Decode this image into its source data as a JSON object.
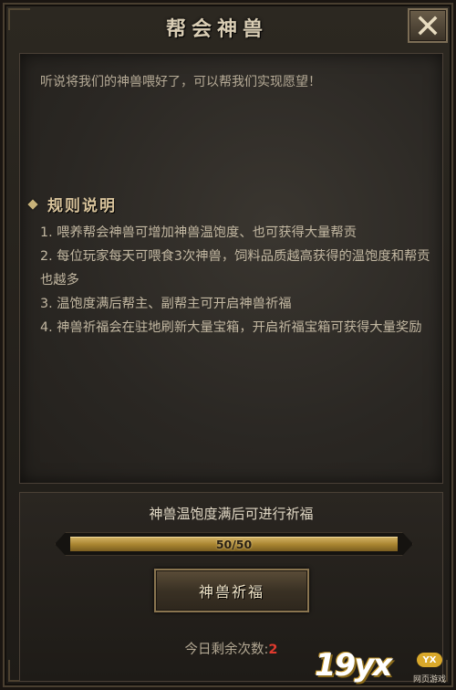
{
  "window": {
    "title": "帮会神兽"
  },
  "intro_text": "听说将我们的神兽喂好了，可以帮我们实现愿望！",
  "rules": {
    "title": "规则说明",
    "items": [
      "1. 喂养帮会神兽可增加神兽温饱度、也可获得大量帮贡",
      "2. 每位玩家每天可喂食3次神兽，饲料品质越高获得的温饱度和帮贡也越多",
      "3. 温饱度满后帮主、副帮主可开启神兽祈福",
      "4. 神兽祈福会在驻地刷新大量宝箱，开启祈福宝箱可获得大量奖励"
    ]
  },
  "satiety": {
    "hint": "神兽温饱度满后可进行祈福",
    "progress_text": "50/50",
    "progress_fraction": 1.0
  },
  "bless_button_label": "神兽祈福",
  "remaining": {
    "label": "今日剩余次数:",
    "count": "2"
  },
  "colors": {
    "accent_gold": "#c9a44e",
    "count_red": "#e03a2e"
  },
  "watermark": {
    "logo": "19yx",
    "badge": "YX",
    "sub": "网页游戏"
  }
}
